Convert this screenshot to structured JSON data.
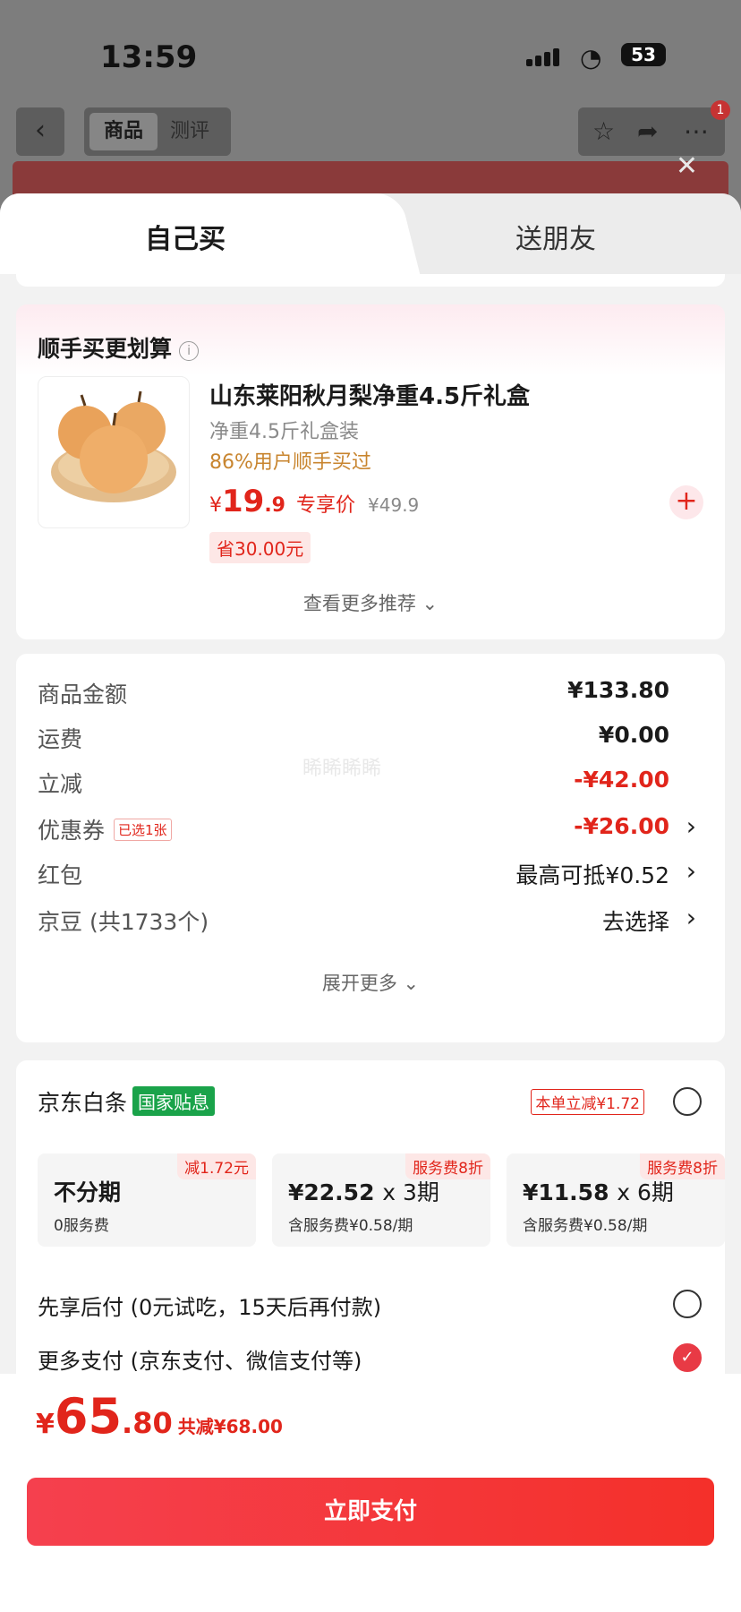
{
  "status_bar": {
    "time": "13:59",
    "battery": "53"
  },
  "top_nav": {
    "tab_product": "商品",
    "tab_review": "测评",
    "badge_count": "1"
  },
  "sheet_tabs": {
    "buy_self": "自己买",
    "gift_friend": "送朋友"
  },
  "recommend": {
    "title": "顺手买更划算",
    "product_name": "山东莱阳秋月梨净重4.5斤礼盒",
    "spec": "净重4.5斤礼盒装",
    "buy_rate": "86%用户顺手买过",
    "price_currency": "¥",
    "price_int": "19",
    "price_dec": ".9",
    "price_tag": "专享价",
    "original_price": "¥49.9",
    "saved": "省30.00元",
    "more_label": "查看更多推荐"
  },
  "fees": {
    "rows": [
      {
        "label": "商品金额",
        "value": "¥133.80"
      },
      {
        "label": "运费",
        "value": "¥0.00"
      },
      {
        "label": "立减",
        "value": "-¥42.00"
      },
      {
        "label": "优惠券",
        "tag": "已选1张",
        "value": "-¥26.00"
      },
      {
        "label": "红包",
        "value": "最高可抵¥0.52"
      },
      {
        "label": "京豆 (共1733个)",
        "value": "去选择"
      }
    ],
    "expand_label": "展开更多"
  },
  "payment": {
    "baitiao_title": "京东白条",
    "subsidy_tag": "国家贴息",
    "discount_tag": "本单立减¥1.72",
    "plans": [
      {
        "title": "不分期",
        "sub": "0服务费",
        "badge": "减1.72元"
      },
      {
        "title": "¥22.52",
        "times": "x 3期",
        "sub": "含服务费¥0.58/期",
        "badge": "服务费8折"
      },
      {
        "title": "¥11.58",
        "times": "x 6期",
        "sub": "含服务费¥0.58/期",
        "badge": "服务费8折"
      }
    ],
    "later_pay": "先享后付 (0元试吃，15天后再付款)",
    "more_pay": "更多支付 (京东支付、微信支付等)"
  },
  "bottom_bar": {
    "currency": "¥",
    "total_int": "65",
    "total_dec": ".80",
    "total_saved": "共减¥68.00",
    "pay_button": "立即支付"
  },
  "colors": {
    "accent": "#e1251b",
    "subsidy_green": "#1aa34a",
    "button_start": "#f5404e",
    "button_end": "#f4302a"
  }
}
